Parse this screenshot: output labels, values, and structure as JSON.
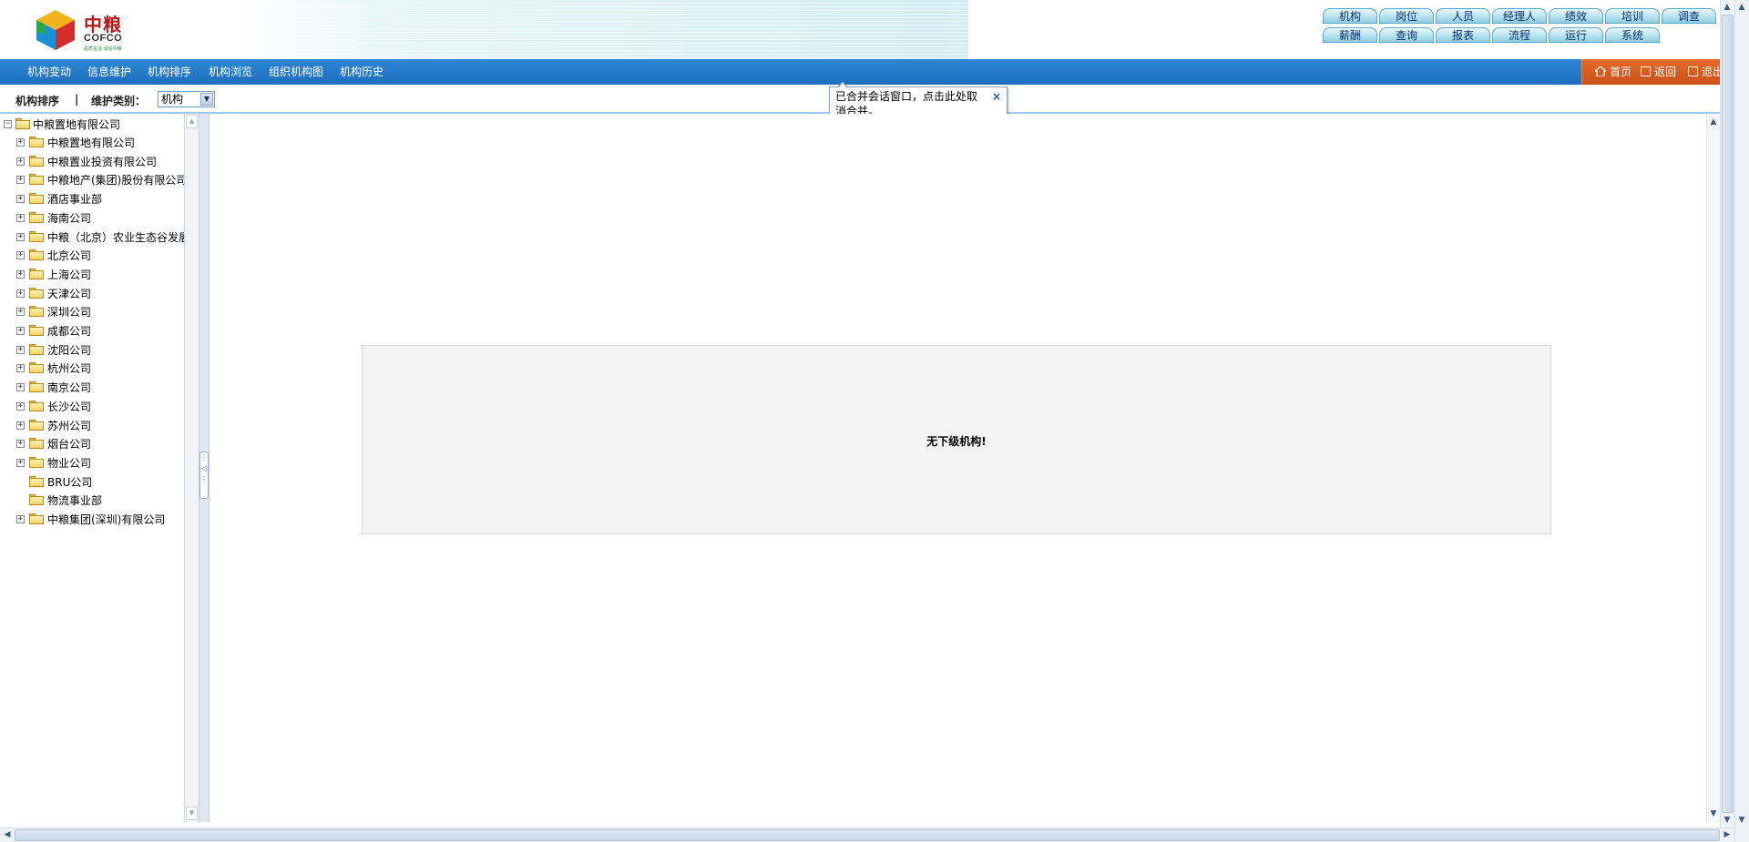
{
  "logo": {
    "cn": "中粮",
    "en": "COFCO",
    "slogan": "品质生活 诚信中粮"
  },
  "topnav": [
    [
      "机构",
      "岗位",
      "人员",
      "经理人",
      "绩效",
      "培训",
      "调查"
    ],
    [
      "薪酬",
      "查询",
      "报表",
      "流程",
      "运行",
      "系统"
    ]
  ],
  "menu": [
    "机构变动",
    "信息维护",
    "机构排序",
    "机构浏览",
    "组织机构图",
    "机构历史"
  ],
  "rightmenu": {
    "home": "首页",
    "back": "返回",
    "logout": "退出"
  },
  "toolbar": {
    "title": "机构排序",
    "sep": "|",
    "type_label": "维护类别：",
    "type_value": "机构"
  },
  "tooltip": {
    "text": "已合并会话窗口，点击此处取消合并。",
    "close": "×"
  },
  "tree": {
    "root": "中粮置地有限公司",
    "items": [
      {
        "label": "中粮置地有限公司",
        "expandable": true
      },
      {
        "label": "中粮置业投资有限公司",
        "expandable": true
      },
      {
        "label": "中粮地产(集团)股份有限公司",
        "expandable": true
      },
      {
        "label": "酒店事业部",
        "expandable": true
      },
      {
        "label": "海南公司",
        "expandable": true
      },
      {
        "label": "中粮（北京）农业生态谷发展",
        "expandable": true
      },
      {
        "label": "北京公司",
        "expandable": true
      },
      {
        "label": "上海公司",
        "expandable": true
      },
      {
        "label": "天津公司",
        "expandable": true
      },
      {
        "label": "深圳公司",
        "expandable": true
      },
      {
        "label": "成都公司",
        "expandable": true
      },
      {
        "label": "沈阳公司",
        "expandable": true
      },
      {
        "label": "杭州公司",
        "expandable": true
      },
      {
        "label": "南京公司",
        "expandable": true
      },
      {
        "label": "长沙公司",
        "expandable": true
      },
      {
        "label": "苏州公司",
        "expandable": true
      },
      {
        "label": "烟台公司",
        "expandable": true
      },
      {
        "label": "物业公司",
        "expandable": true
      },
      {
        "label": "BRU公司",
        "expandable": false
      },
      {
        "label": "物流事业部",
        "expandable": false
      },
      {
        "label": "中粮集团(深圳)有限公司",
        "expandable": true
      }
    ]
  },
  "main": {
    "message": "无下级机构!"
  },
  "icons": {
    "expand": "plus-box-icon",
    "collapse": "minus-box-icon",
    "folder": "folder-icon"
  }
}
